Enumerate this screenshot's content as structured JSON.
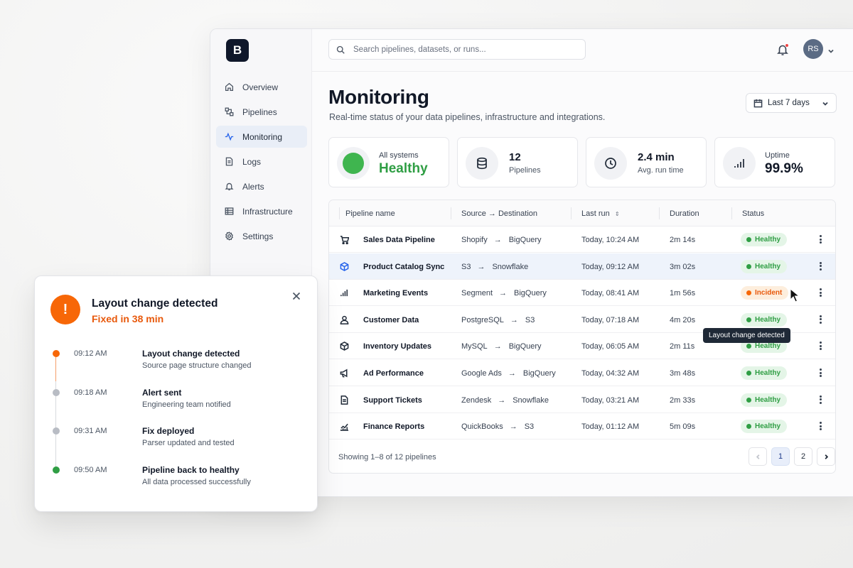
{
  "app": {
    "logo_letter": "B",
    "search_placeholder": "Search pipelines, datasets, or runs...",
    "avatar_initials": "RS",
    "accent_color": "#2563eb"
  },
  "sidebar": {
    "items": [
      {
        "label": "Overview",
        "icon": "home-icon",
        "active": false
      },
      {
        "label": "Pipelines",
        "icon": "pipeline-icon",
        "active": false
      },
      {
        "label": "Monitoring",
        "icon": "activity-icon",
        "active": true
      },
      {
        "label": "Logs",
        "icon": "file-icon",
        "active": false
      },
      {
        "label": "Alerts",
        "icon": "bell-icon",
        "active": false
      },
      {
        "label": "Infrastructure",
        "icon": "server-icon",
        "active": false
      },
      {
        "label": "Settings",
        "icon": "gear-icon",
        "active": false
      }
    ]
  },
  "page": {
    "title": "Monitoring",
    "subtitle": "Real-time status of your data pipelines, infrastructure and integrations.",
    "date_range": "Last 7 days"
  },
  "stats": {
    "systems": {
      "label": "All systems",
      "value": "Healthy",
      "color": "#2f9e44"
    },
    "pipelines": {
      "value": "12",
      "label": "Pipelines"
    },
    "runtime": {
      "value": "2.4 min",
      "label": "Avg. run time"
    },
    "uptime": {
      "label": "Uptime",
      "value": "99.9%"
    }
  },
  "table": {
    "columns": [
      "Pipeline name",
      "Source → Destination",
      "Last run",
      "Duration",
      "Status"
    ],
    "arrow": "→",
    "rows": [
      {
        "name": "Sales Data Pipeline",
        "icon": "cart-icon",
        "source": "Shopify",
        "dest": "BigQuery",
        "last_run": "Today, 10:24 AM",
        "duration": "2m 14s",
        "status": "Healthy"
      },
      {
        "name": "Product Catalog Sync",
        "icon": "cube-icon",
        "source": "S3",
        "dest": "Snowflake",
        "last_run": "Today, 09:12 AM",
        "duration": "3m 02s",
        "status": "Healthy"
      },
      {
        "name": "Marketing Events",
        "icon": "bar-chart-icon",
        "source": "Segment",
        "dest": "BigQuery",
        "last_run": "Today, 08:41 AM",
        "duration": "1m 56s",
        "status": "Incident"
      },
      {
        "name": "Customer Data",
        "icon": "user-icon",
        "source": "PostgreSQL",
        "dest": "S3",
        "last_run": "Today, 07:18 AM",
        "duration": "4m 20s",
        "status": "Healthy"
      },
      {
        "name": "Inventory Updates",
        "icon": "cube-icon",
        "source": "MySQL",
        "dest": "BigQuery",
        "last_run": "Today, 06:05 AM",
        "duration": "2m 11s",
        "status": "Healthy"
      },
      {
        "name": "Ad Performance",
        "icon": "megaphone-icon",
        "source": "Google Ads",
        "dest": "BigQuery",
        "last_run": "Today, 04:32 AM",
        "duration": "3m 48s",
        "status": "Healthy"
      },
      {
        "name": "Support Tickets",
        "icon": "document-icon",
        "source": "Zendesk",
        "dest": "Snowflake",
        "last_run": "Today, 03:21 AM",
        "duration": "2m 33s",
        "status": "Healthy"
      },
      {
        "name": "Finance Reports",
        "icon": "line-chart-icon",
        "source": "QuickBooks",
        "dest": "S3",
        "last_run": "Today, 01:12 AM",
        "duration": "5m 09s",
        "status": "Healthy"
      }
    ],
    "tooltip": "Layout change detected",
    "footer_text": "Showing 1–8 of 12 pipelines",
    "pages": [
      "1",
      "2"
    ]
  },
  "incident": {
    "title": "Layout change detected",
    "subtitle": "Fixed in 38 min",
    "icon_glyph": "!",
    "timeline": [
      {
        "time": "09:12 AM",
        "title": "Layout change detected",
        "desc": "Source page structure changed",
        "color": "#f76707"
      },
      {
        "time": "09:18 AM",
        "title": "Alert sent",
        "desc": "Engineering team notified",
        "color": "#b8bcc4"
      },
      {
        "time": "09:31 AM",
        "title": "Fix deployed",
        "desc": "Parser updated and tested",
        "color": "#b8bcc4"
      },
      {
        "time": "09:50 AM",
        "title": "Pipeline back to healthy",
        "desc": "All data processed successfully",
        "color": "#2f9e44"
      }
    ]
  }
}
